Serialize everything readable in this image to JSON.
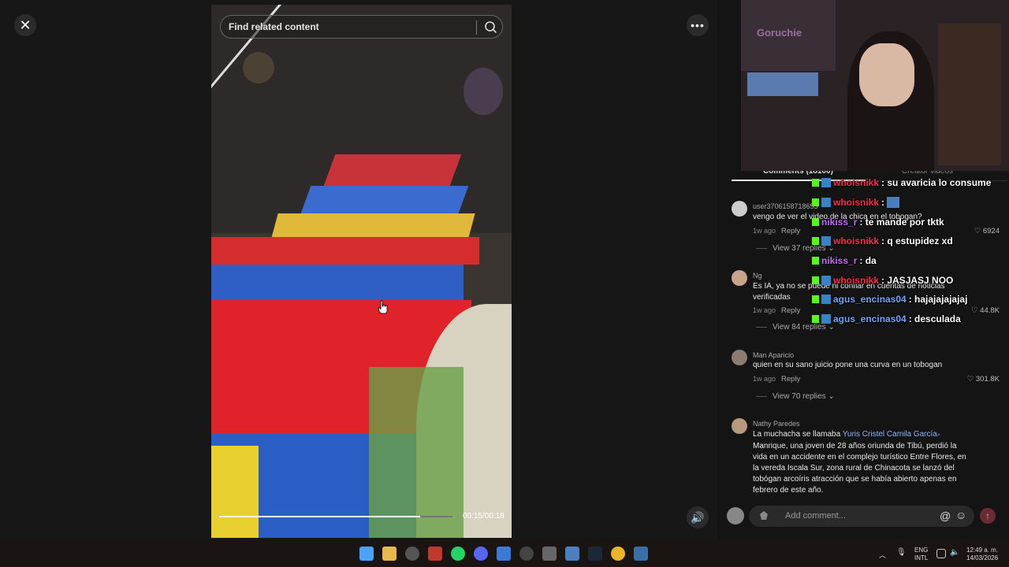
{
  "viewer": {
    "search_placeholder": "Find related content",
    "time": "00:15/00:18",
    "progress": 0.86
  },
  "tabs": {
    "comments": "Comments (18100)",
    "creator": "Creator videos"
  },
  "comments": [
    {
      "name": "user3706158718653",
      "text": "vengo de ver el video de la chica en el tobogan?",
      "age": "1w ago",
      "reply": "Reply",
      "likes": "6924",
      "view": "View 37 replies"
    },
    {
      "name": "Ng",
      "text": "Es IA, ya no se puede ni confiar en cuentas de noticias verificadas",
      "age": "1w ago",
      "reply": "Reply",
      "likes": "44.8K",
      "view": "View 84 replies"
    },
    {
      "name": "Man Aparicio",
      "text": "quien en su sano juicio pone una curva en un tobogan",
      "age": "1w ago",
      "reply": "Reply",
      "likes": "301.8K",
      "view": "View 70 replies"
    },
    {
      "name": "Nathy Paredes",
      "text_pre": "La muchacha se llamaba ",
      "mention": "Yuris Cristel Camila García",
      "text_post": "Manrique, una joven de 28 años oriunda de Tibú, perdió la vida en un accidente en el complejo turístico Entre Flores, en la vereda Iscala Sur, zona rural de Chinacota se lanzó del tobógan arcoíris atracción que se había abierto apenas en febrero de este año."
    }
  ],
  "comment_input": {
    "placeholder": "Add comment..."
  },
  "webcam": {
    "name": "Goruchie"
  },
  "chat": [
    {
      "user": "whoisnikk",
      "msg": ": su avaricia lo consume",
      "color": "#ff2a4a",
      "badges": 2
    },
    {
      "user": "whoisnikk",
      "msg": ":",
      "color": "#ff2a4a",
      "badges": 2
    },
    {
      "user": "nikiss_r",
      "msg": ": te mande por tktk",
      "color": "#c56bff",
      "badges": 1
    },
    {
      "user": "whoisnikk",
      "msg": ": q estupidez xd",
      "color": "#ff2a4a",
      "badges": 2
    },
    {
      "user": "nikiss_r",
      "msg": ": da",
      "color": "#c56bff",
      "badges": 1
    },
    {
      "user": "whoisnikk",
      "msg": ": JASJASJ NOO",
      "color": "#ff2a4a",
      "badges": 2
    },
    {
      "user": "agus_encinas04",
      "msg": ": hajajajajajaj",
      "color": "#6fa4ff",
      "badges": 2
    },
    {
      "user": "agus_encinas04",
      "msg": ": desculada",
      "color": "#6fa4ff",
      "badges": 2
    }
  ],
  "taskbar": {
    "lang": "ENG",
    "layout": "INTL",
    "time": "12:49 a. m.",
    "date": "14/03/2026"
  }
}
